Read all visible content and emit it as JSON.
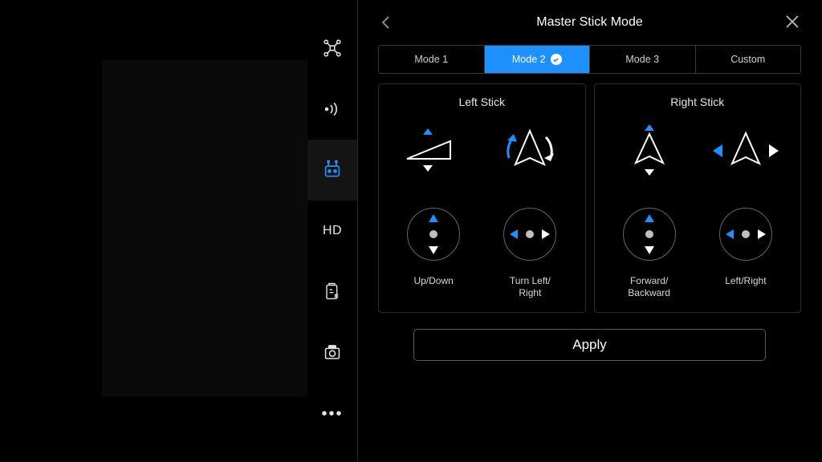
{
  "colors": {
    "accent": "#1e90ff",
    "white": "#ffffff"
  },
  "header": {
    "title": "Master Stick Mode"
  },
  "tabs": {
    "items": [
      {
        "label": "Mode 1"
      },
      {
        "label": "Mode 2",
        "selected": true
      },
      {
        "label": "Mode 3"
      },
      {
        "label": "Custom"
      }
    ]
  },
  "sticks": {
    "left": {
      "title": "Left Stick",
      "axis_v": "Up/Down",
      "axis_h": "Turn Left/\nRight"
    },
    "right": {
      "title": "Right Stick",
      "axis_v": "Forward/\nBackward",
      "axis_h": "Left/Right"
    }
  },
  "apply_label": "Apply",
  "sidebar": {
    "hd_label": "HD"
  }
}
